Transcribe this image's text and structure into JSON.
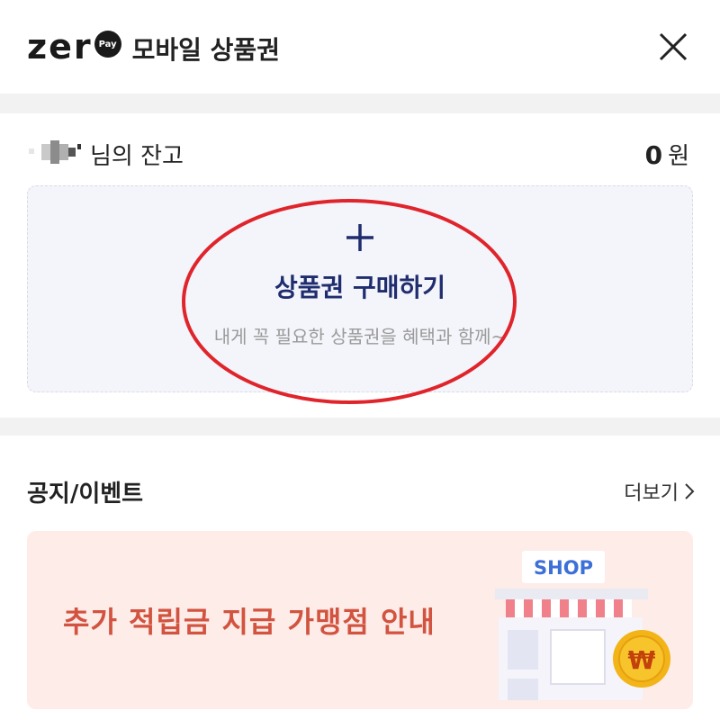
{
  "header": {
    "logo_word": "zer",
    "logo_badge": "Pay",
    "title": "모바일 상품권",
    "close_icon": "close-icon"
  },
  "balance": {
    "label": "님의 잔고",
    "amount": "0",
    "currency": "원"
  },
  "purchase": {
    "icon": "plus-icon",
    "title": "상품권 구매하기",
    "subtitle": "내게 꼭 필요한 상품권을 혜택과 함께~",
    "highlight_color": "#e0242b"
  },
  "notice": {
    "title": "공지/이벤트",
    "more_label": "더보기",
    "banner": {
      "text": "추가 적립금 지급 가맹점 안내",
      "shop_sign": "SHOP",
      "coin_symbol": "₩"
    }
  },
  "colors": {
    "accent_navy": "#1f2d6e",
    "banner_bg": "#fdece8",
    "banner_text": "#d2533f",
    "shop_sign": "#3d6fd8"
  }
}
